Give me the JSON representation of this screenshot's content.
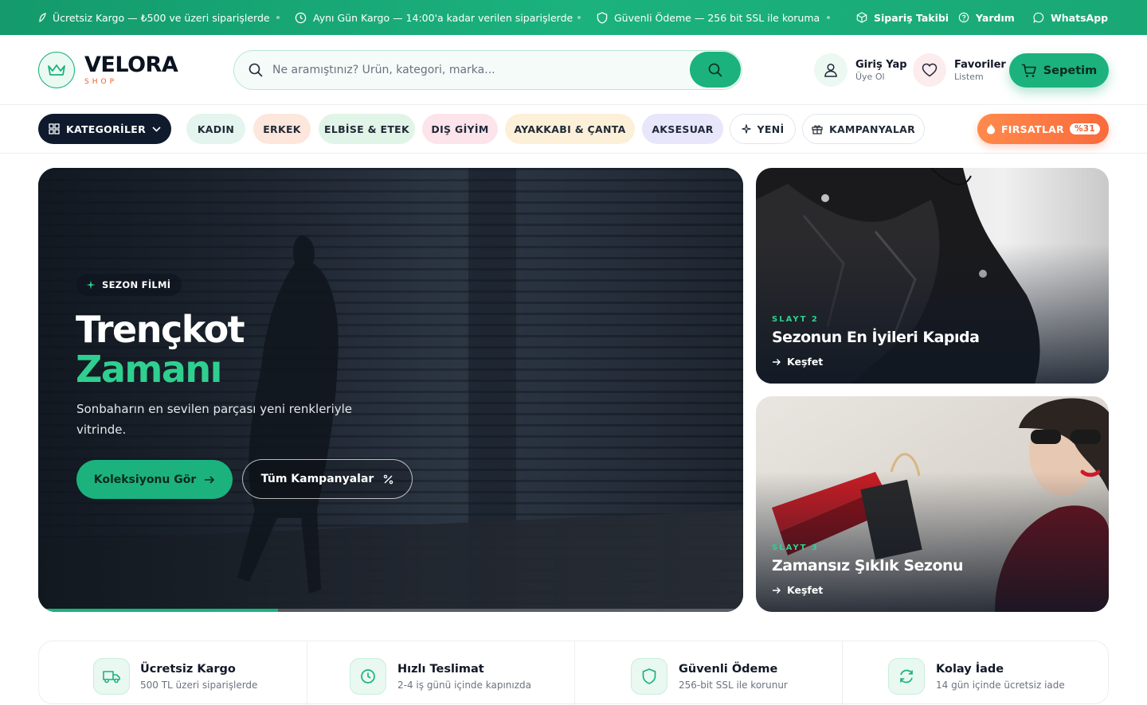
{
  "topbar": {
    "shipping_text": "Ücretsiz Kargo — ₺500 ve üzeri siparişlerde",
    "sameday_text": "Aynı Gün Kargo — 14:00'a kadar verilen siparişlerde",
    "secure_text": "Güvenli Ödeme — 256 bit SSL ile koruma",
    "order_tracking": "Sipariş Takibi",
    "help": "Yardım",
    "whatsapp": "WhatsApp"
  },
  "header": {
    "logo_title": "VELORA",
    "logo_sub": "SHOP",
    "search_placeholder": "Ne aramıştınız? Ürün, kategori, marka...",
    "login_title": "Giriş Yap",
    "login_sub": "Üye Ol",
    "fav_title": "Favoriler",
    "fav_sub": "Listem",
    "cart_label": "Sepetim"
  },
  "nav": {
    "categories_label": "KATEGORİLER",
    "items": [
      {
        "label": "KADIN",
        "bg": "#e3f5ee"
      },
      {
        "label": "ERKEK",
        "bg": "#fde6dc"
      },
      {
        "label": "ELBİSE & ETEK",
        "bg": "#e1f4e8"
      },
      {
        "label": "DIŞ GİYİM",
        "bg": "#fde3ea"
      },
      {
        "label": "AYAKKABI & ÇANTA",
        "bg": "#fdf0d8"
      },
      {
        "label": "AKSESUAR",
        "bg": "#e8e6fb"
      }
    ],
    "new_label": "YENİ",
    "campaigns_label": "KAMPANYALAR",
    "deals_label": "FIRSATLAR",
    "deals_badge": "%31"
  },
  "hero": {
    "badge": "SEZON FİLMİ",
    "title_line1": "Trençkot",
    "title_line2": "Zamanı",
    "description": "Sonbaharın en sevilen parçası yeni renkleriyle vitrinde.",
    "primary_button": "Koleksiyonu Gör",
    "secondary_button": "Tüm Kampanyalar",
    "progress": 0.34
  },
  "slides": [
    {
      "label": "SLAYT 2",
      "title": "Sezonun En İyileri Kapıda",
      "link": "Keşfet"
    },
    {
      "label": "SLAYT 3",
      "title": "Zamansız Şıklık Sezonu",
      "link": "Keşfet"
    }
  ],
  "features": [
    {
      "title": "Ücretsiz Kargo",
      "subtitle": "500 TL üzeri siparişlerde",
      "icon": "truck-icon"
    },
    {
      "title": "Hızlı Teslimat",
      "subtitle": "2-4 iş günü içinde kapınızda",
      "icon": "clock-icon"
    },
    {
      "title": "Güvenli Ödeme",
      "subtitle": "256-bit SSL ile korunur",
      "icon": "shield-icon"
    },
    {
      "title": "Kolay İade",
      "subtitle": "14 gün içinde ücretsiz iade",
      "icon": "refresh-icon"
    }
  ],
  "colors": {
    "accent": "#1bb27e",
    "accent_light": "#2fd08f",
    "dark": "#0f1b2d",
    "orange": "#f96a3c"
  }
}
